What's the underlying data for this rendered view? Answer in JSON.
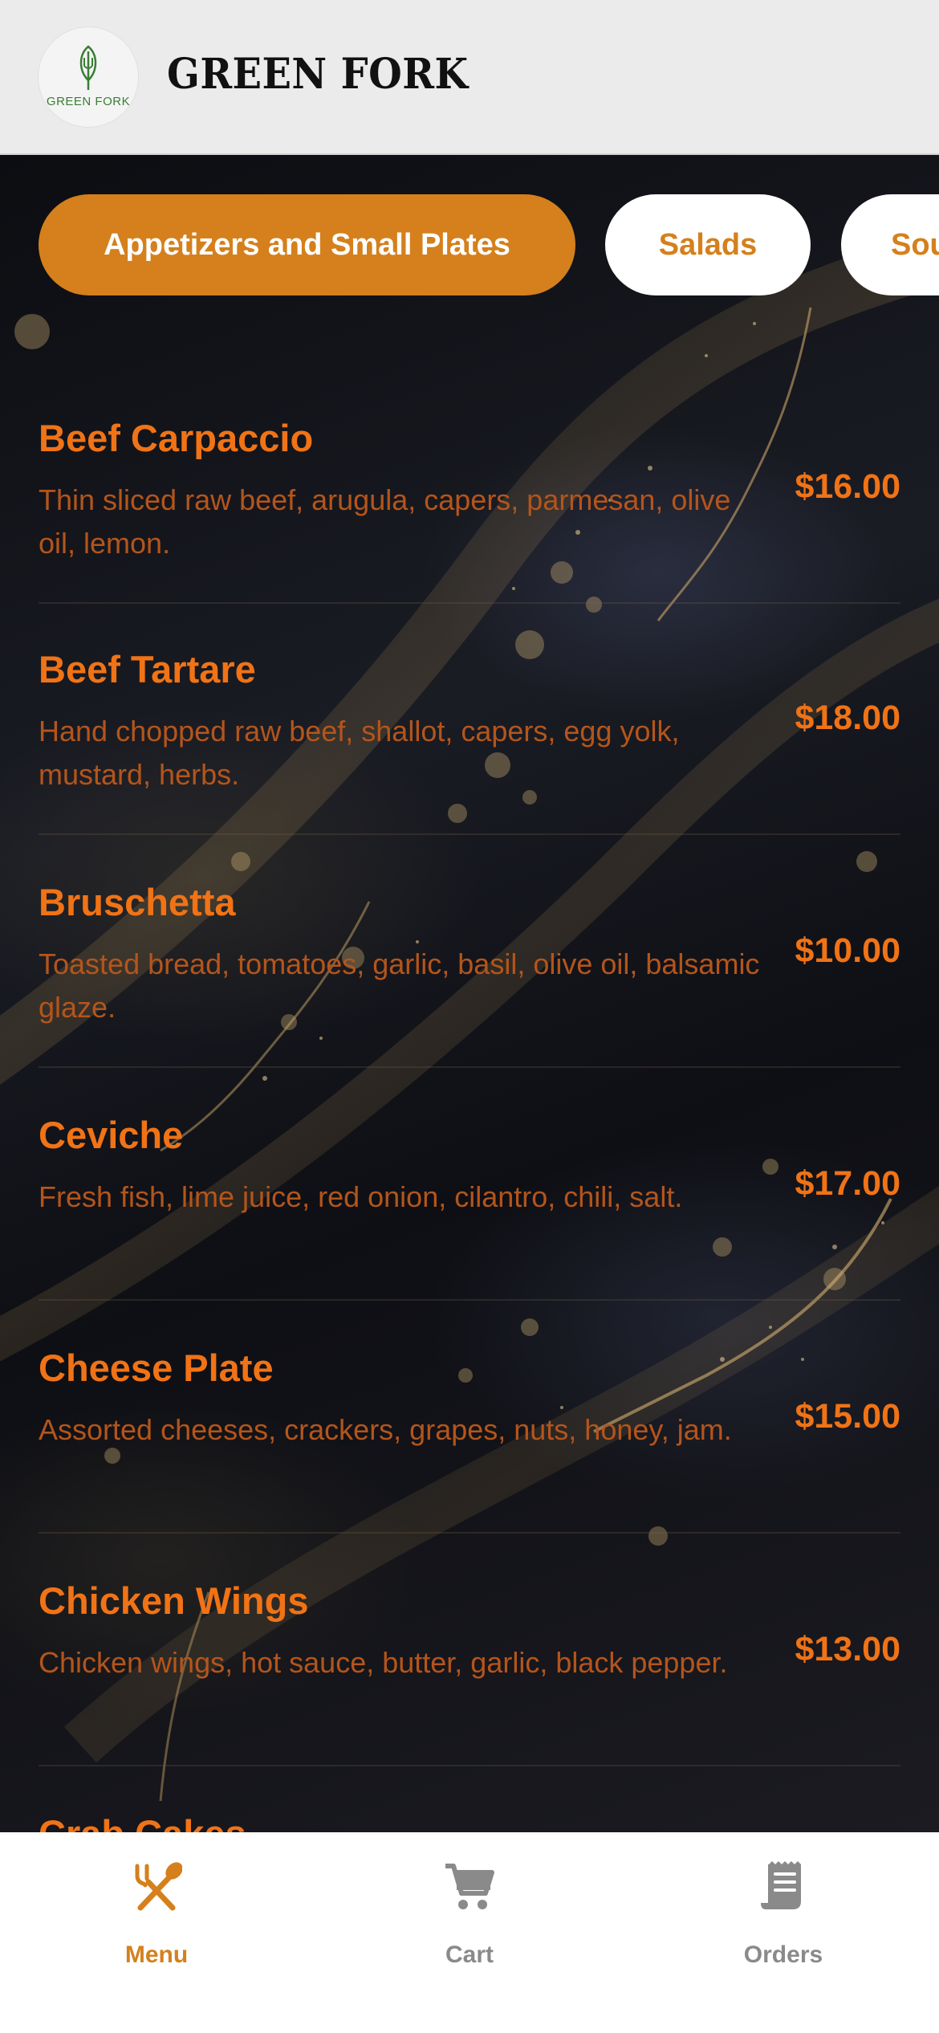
{
  "header": {
    "logo_text": "GREEN FORK",
    "brand": "GREEN FORK"
  },
  "tabs": [
    {
      "label": "Appetizers and Small Plates",
      "active": true
    },
    {
      "label": "Salads",
      "active": false
    },
    {
      "label": "Sou",
      "active": false
    }
  ],
  "items": [
    {
      "name": "Beef Carpaccio",
      "desc": "Thin sliced raw beef, arugula, capers, parmesan, olive oil, lemon.",
      "price": "$16.00"
    },
    {
      "name": "Beef Tartare",
      "desc": "Hand chopped raw beef, shallot, capers, egg yolk, mustard, herbs.",
      "price": "$18.00"
    },
    {
      "name": "Bruschetta",
      "desc": "Toasted bread, tomatoes, garlic, basil, olive oil, balsamic glaze.",
      "price": "$10.00"
    },
    {
      "name": "Ceviche",
      "desc": "Fresh fish, lime juice, red onion, cilantro, chili, salt.",
      "price": "$17.00"
    },
    {
      "name": "Cheese Plate",
      "desc": "Assorted cheeses, crackers, grapes, nuts, honey, jam.",
      "price": "$15.00"
    },
    {
      "name": "Chicken Wings",
      "desc": "Chicken wings, hot sauce, butter, garlic, black pepper.",
      "price": "$13.00"
    },
    {
      "name": "Crab Cakes",
      "desc": "",
      "price": ""
    }
  ],
  "nav": {
    "menu": {
      "label": "Menu",
      "icon": "fork-spoon-icon",
      "active": true
    },
    "cart": {
      "label": "Cart",
      "icon": "cart-icon",
      "active": false
    },
    "orders": {
      "label": "Orders",
      "icon": "receipt-icon",
      "active": false
    }
  },
  "colors": {
    "accent": "#d5801c",
    "item_text": "#f07316",
    "desc_text": "#b4551b",
    "header_bg": "#ebebeb",
    "nav_inactive": "#8a8a8a"
  }
}
